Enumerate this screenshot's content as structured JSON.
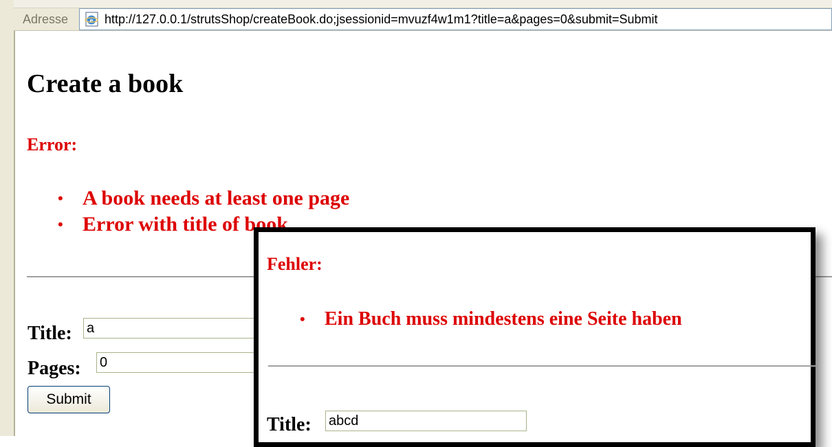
{
  "browser": {
    "address_label": "Adresse",
    "address_url": "http://127.0.0.1/strutsShop/createBook.do;jsessionid=mvuzf4w1m1?title=a&pages=0&submit=Submit",
    "page_icon": "ie-page-icon"
  },
  "page": {
    "title": "Create a book",
    "error_heading": "Error:",
    "errors": [
      "A book needs at least one page",
      "Error with title of book"
    ],
    "form": {
      "title_label": "Title:",
      "title_value": "a",
      "pages_label": "Pages:",
      "pages_value": "0",
      "submit_label": "Submit"
    }
  },
  "overlay": {
    "error_heading": "Fehler:",
    "errors": [
      "Ein Buch muss mindestens eine Seite haben"
    ],
    "form": {
      "title_label": "Title:",
      "title_value": "abcd"
    }
  },
  "colors": {
    "error_red": "#dd0000",
    "chrome": "#ece9d8"
  }
}
